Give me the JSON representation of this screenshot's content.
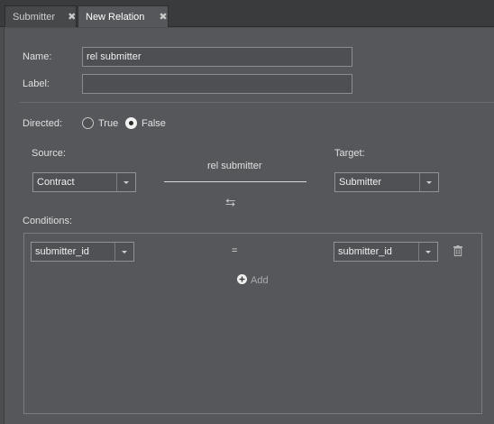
{
  "tabs": [
    {
      "label": "Submitter",
      "close": "✖"
    },
    {
      "label": "New Relation",
      "close": "✖"
    }
  ],
  "form": {
    "name_label": "Name:",
    "name_value": "rel submitter",
    "label_label": "Label:",
    "label_value": "",
    "directed_label": "Directed:",
    "directed_options": [
      "True",
      "False"
    ],
    "directed_selected": "False",
    "source_label": "Source:",
    "source_value": "Contract",
    "target_label": "Target:",
    "target_value": "Submitter",
    "relation_name": "rel submitter",
    "swap_icon": "⮀",
    "conditions_label": "Conditions:",
    "conditions": [
      {
        "left": "submitter_id",
        "operator": "=",
        "right": "submitter_id"
      }
    ],
    "add_label": "Add"
  }
}
